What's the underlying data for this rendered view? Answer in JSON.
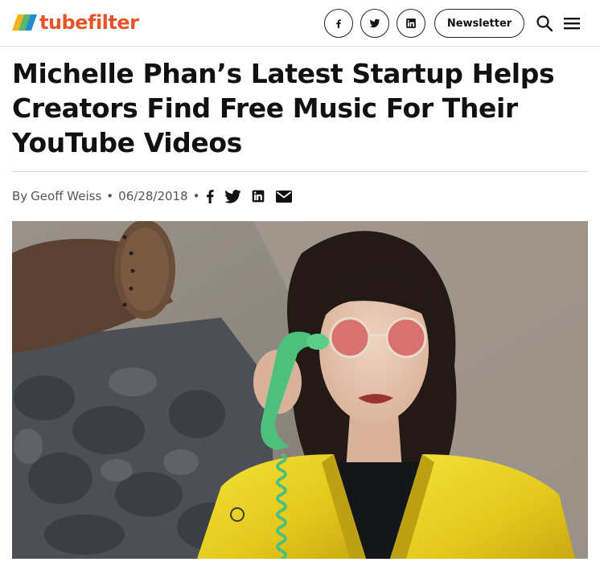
{
  "site": {
    "logo_text": "tubefilter",
    "brand_color": "#e8542a",
    "logo_stripe_colors": [
      "#f2b316",
      "#5db66e",
      "#1f8ec9"
    ]
  },
  "header": {
    "social_icons": [
      "facebook-icon",
      "twitter-icon",
      "linkedin-icon"
    ],
    "newsletter_label": "Newsletter",
    "search_icon": "search-icon",
    "menu_icon": "hamburger-menu-icon"
  },
  "article": {
    "headline_lines": [
      "Michelle Phan’s Latest Startup Helps",
      "Creators Find Free Music For Their",
      "YouTube Videos"
    ],
    "byline": {
      "by": "By",
      "author": "Geoff Weiss",
      "separator": "•",
      "date": "06/28/2018",
      "trailing_separator": "•"
    },
    "share_icons": [
      "facebook-icon",
      "twitter-icon",
      "linkedin-icon",
      "email-icon"
    ]
  },
  "hero_image": {
    "subject": "woman in yellow leather jacket and red round sunglasses holding green telephone receiver"
  }
}
